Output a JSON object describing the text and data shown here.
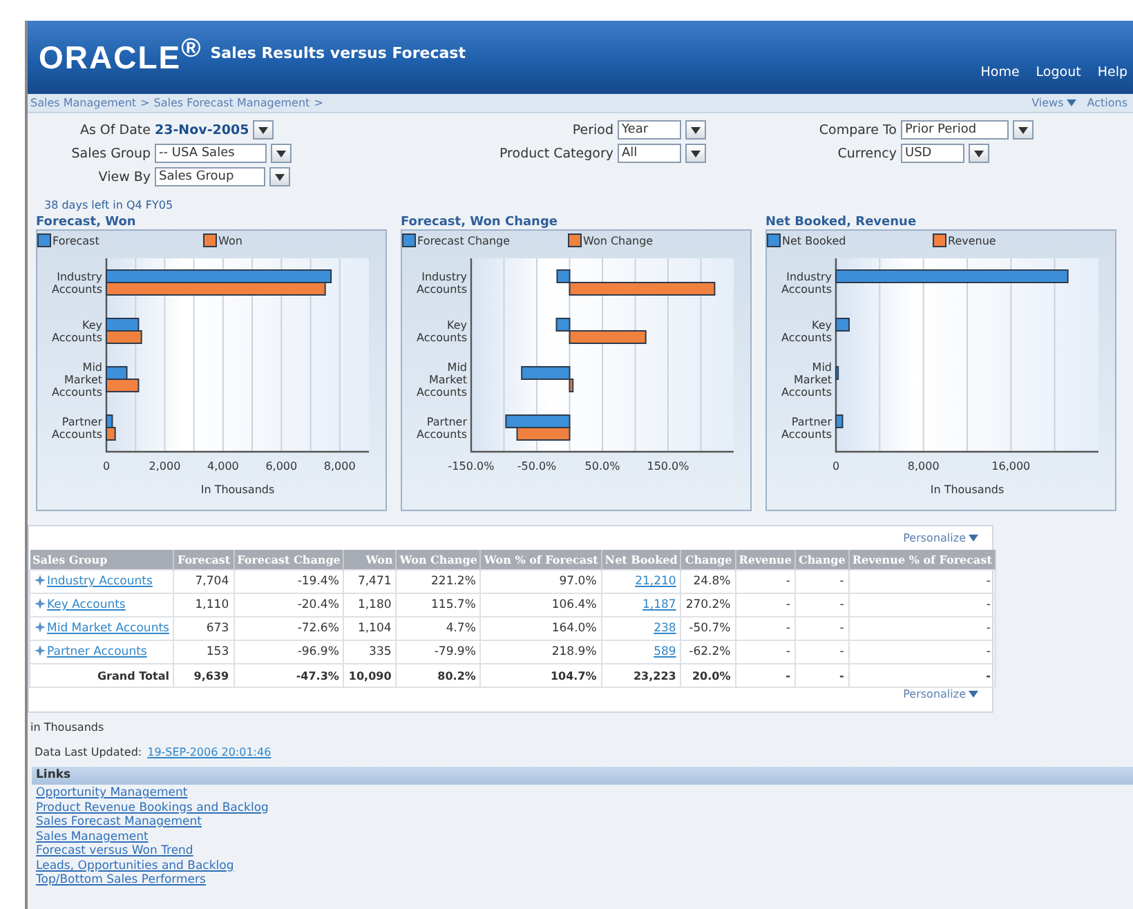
{
  "header": {
    "logo": "ORACLE$^{®}$",
    "title": "Sales Results versus Forecast",
    "nav": [
      "Home",
      "Logout",
      "Help"
    ]
  },
  "breadcrumb": {
    "items": [
      "Sales Management",
      "Sales Forecast Management"
    ],
    "separator": ">"
  },
  "menus": [
    "Views",
    "Actions"
  ],
  "parameters": [
    {
      "label": "As Of Date",
      "value": "23-Nov-2005",
      "kind": "date"
    },
    {
      "label": "Period",
      "value": "Year",
      "kind": "select"
    },
    {
      "label": "Compare To",
      "value": "Prior Period",
      "kind": "select"
    },
    {
      "label": "Sales Group",
      "value": "-- USA Sales",
      "kind": "select"
    },
    {
      "label": "Product Category",
      "value": "All",
      "kind": "select"
    },
    {
      "label": "Currency",
      "value": "USD",
      "kind": "select"
    },
    {
      "label": "View By",
      "value": "Sales Group",
      "kind": "select"
    }
  ],
  "days_left": "38 days left in Q4 FY05",
  "charts": [
    {
      "title": "Forecast, Won",
      "chart_data": {
        "type": "bar",
        "orientation": "horizontal",
        "grid": true,
        "legend": "top",
        "xlabel": "In Thousands",
        "categories": [
          "Industry Accounts",
          "Key Accounts",
          "Mid Market Accounts",
          "Partner Accounts"
        ],
        "xlim": [
          0,
          9000
        ],
        "xticks": [
          {
            "value": 0,
            "label": "0"
          },
          {
            "value": 2000,
            "label": "2,000"
          },
          {
            "value": 4000,
            "label": "4,000"
          },
          {
            "value": 6000,
            "label": "6,000"
          },
          {
            "value": 8000,
            "label": "8,000"
          }
        ],
        "series": [
          {
            "name": "Forecast",
            "color": "#3d8fd9",
            "values": [
              7700,
              1100,
              700,
              200
            ]
          },
          {
            "name": "Won",
            "color": "#f0813f",
            "values": [
              7500,
              1200,
              1100,
              300
            ]
          }
        ]
      }
    },
    {
      "title": "Forecast, Won Change",
      "chart_data": {
        "type": "bar",
        "orientation": "horizontal",
        "grid": true,
        "legend": "top",
        "categories": [
          "Industry Accounts",
          "Key Accounts",
          "Mid Market Accounts",
          "Partner Accounts"
        ],
        "xlim": [
          -150,
          250
        ],
        "xticks": [
          {
            "value": -150,
            "label": "-150.0%"
          },
          {
            "value": -50,
            "label": "-50.0%"
          },
          {
            "value": 50,
            "label": "50.0%"
          },
          {
            "value": 150,
            "label": "150.0%"
          }
        ],
        "series": [
          {
            "name": "Forecast Change",
            "color": "#3d8fd9",
            "values": [
              -19,
              -20,
              -73,
              -97
            ]
          },
          {
            "name": "Won Change",
            "color": "#f0813f",
            "values": [
              221,
              116,
              5,
              -80
            ]
          }
        ]
      }
    },
    {
      "title": "Net Booked, Revenue",
      "chart_data": {
        "type": "bar",
        "orientation": "horizontal",
        "grid": true,
        "legend": "top",
        "xlabel": "In Thousands",
        "categories": [
          "Industry Accounts",
          "Key Accounts",
          "Mid Market Accounts",
          "Partner Accounts"
        ],
        "xlim": [
          0,
          24000
        ],
        "xticks": [
          {
            "value": 0,
            "label": "0"
          },
          {
            "value": 8000,
            "label": "8,000"
          },
          {
            "value": 16000,
            "label": "16,000"
          }
        ],
        "series": [
          {
            "name": "Net Booked",
            "color": "#3d8fd9",
            "values": [
              21200,
              1200,
              200,
              600
            ]
          },
          {
            "name": "Revenue",
            "color": "#f0813f",
            "values": [
              null,
              null,
              null,
              null
            ]
          }
        ]
      }
    }
  ],
  "table": {
    "personalize": [
      "Personalize",
      "Personalize"
    ],
    "columns": [
      {
        "label": "Sales Group",
        "kind": "link"
      },
      {
        "label": "Forecast",
        "kind": "number"
      },
      {
        "label": "Forecast Change",
        "kind": "number"
      },
      {
        "label": "Won",
        "kind": "number"
      },
      {
        "label": "Won Change",
        "kind": "number"
      },
      {
        "label": "Won % of Forecast",
        "kind": "number"
      },
      {
        "label": "Net Booked",
        "kind": "link"
      },
      {
        "label": "Change",
        "kind": "number"
      },
      {
        "label": "Revenue",
        "kind": "number"
      },
      {
        "label": "Change",
        "kind": "number"
      },
      {
        "label": "Revenue % of Forecast",
        "kind": "number"
      }
    ],
    "rows": [
      {
        "kind": "group",
        "cells": [
          "Industry Accounts",
          "7,704",
          "-19.4%",
          "7,471",
          "221.2%",
          "97.0%",
          "21,210",
          "24.8%",
          "-",
          "-",
          "-"
        ]
      },
      {
        "kind": "group",
        "cells": [
          "Key Accounts",
          "1,110",
          "-20.4%",
          "1,180",
          "115.7%",
          "106.4%",
          "1,187",
          "270.2%",
          "-",
          "-",
          "-"
        ]
      },
      {
        "kind": "group",
        "cells": [
          "Mid Market Accounts",
          "673",
          "-72.6%",
          "1,104",
          "4.7%",
          "164.0%",
          "238",
          "-50.7%",
          "-",
          "-",
          "-"
        ]
      },
      {
        "kind": "group",
        "cells": [
          "Partner Accounts",
          "153",
          "-96.9%",
          "335",
          "-79.9%",
          "218.9%",
          "589",
          "-62.2%",
          "-",
          "-",
          "-"
        ]
      },
      {
        "kind": "total",
        "cells": [
          "Grand Total",
          "9,639",
          "-47.3%",
          "10,090",
          "80.2%",
          "104.7%",
          "23,223",
          "20.0%",
          "-",
          "-",
          "-"
        ]
      }
    ]
  },
  "note": "in Thousands",
  "last_updated": {
    "label": "Data Last Updated:",
    "value": "19-SEP-2006 20:01:46"
  },
  "links": {
    "title": "Links",
    "items": [
      "Opportunity Management",
      "Product Revenue Bookings and Backlog",
      "Sales Forecast Management",
      "Sales Management",
      "Forecast versus Won Trend",
      "Leads, Opportunities and Backlog",
      "Top/Bottom Sales Performers"
    ]
  }
}
